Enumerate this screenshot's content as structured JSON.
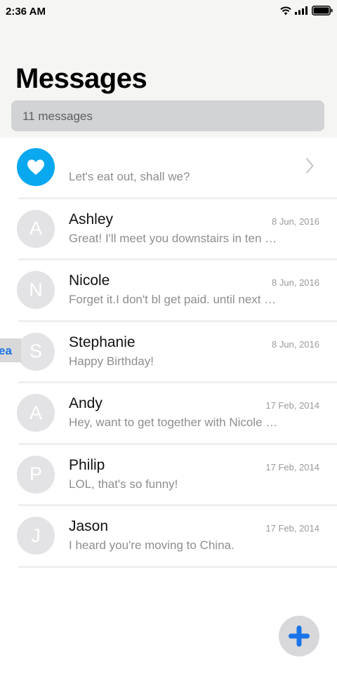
{
  "status": {
    "time": "2:36 AM"
  },
  "header": {
    "title": "Messages",
    "count_label": "11 messages"
  },
  "swipe_action": {
    "label": "ea"
  },
  "conversations": [
    {
      "name": "",
      "initial": "",
      "date": "",
      "preview": "Let's eat out, shall we?"
    },
    {
      "name": "Ashley",
      "initial": "A",
      "date": "8 Jun, 2016",
      "preview": "Great! I'll meet you downstairs in ten minutes"
    },
    {
      "name": "Nicole",
      "initial": "N",
      "date": "8 Jun, 2016",
      "preview": "Forget it.I don't bl get paid. until next Friday"
    },
    {
      "name": "Stephanie",
      "initial": "S",
      "date": "8 Jun, 2016",
      "preview": "Happy Birthday!"
    },
    {
      "name": "Andy",
      "initial": "A",
      "date": "17 Feb, 2014",
      "preview": "Hey, want to get together with Nicole tonight?"
    },
    {
      "name": "Philip",
      "initial": "P",
      "date": "17 Feb, 2014",
      "preview": "LOL, that's so funny!"
    },
    {
      "name": "Jason",
      "initial": "J",
      "date": "17 Feb, 2014",
      "preview": "I heard you're moving to China."
    }
  ],
  "colors": {
    "accent": "#0aa8ef",
    "fab_plus": "#1a73e8"
  }
}
